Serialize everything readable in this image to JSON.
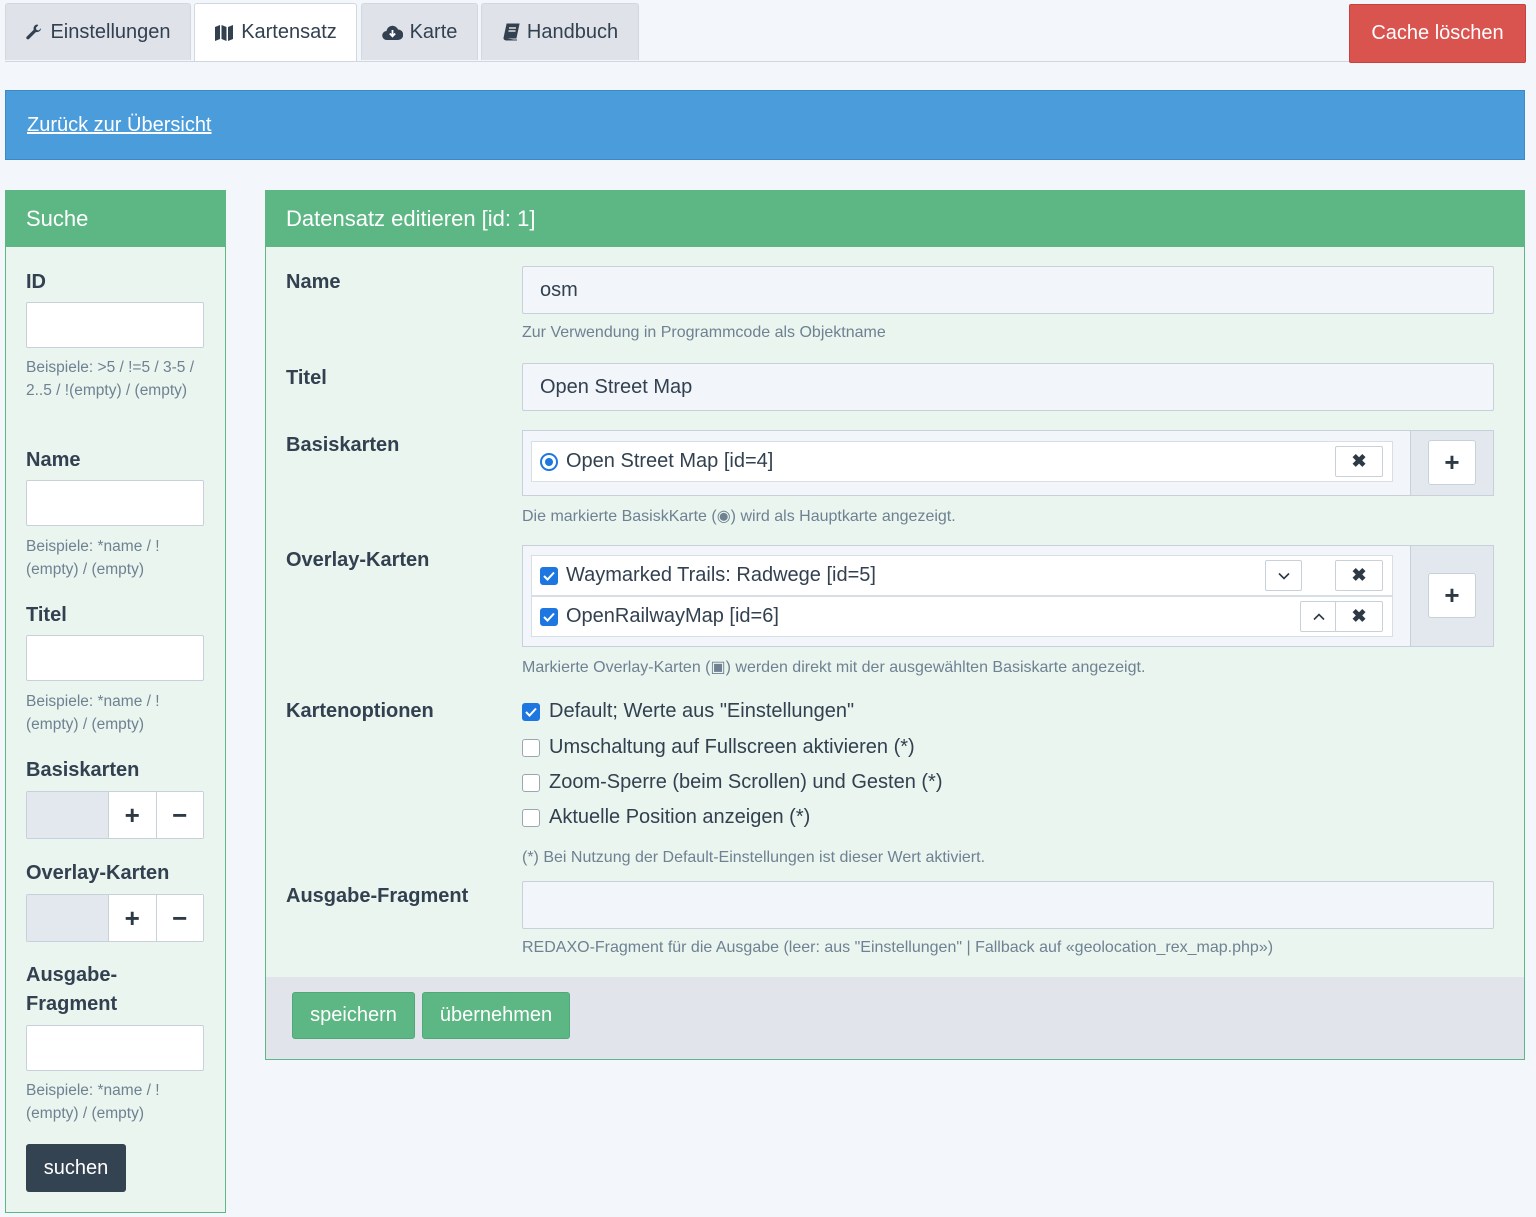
{
  "tabs": [
    {
      "label": "Einstellungen",
      "icon": "wrench-icon"
    },
    {
      "label": "Kartensatz",
      "icon": "map-icon"
    },
    {
      "label": "Karte",
      "icon": "cloud-download-icon"
    },
    {
      "label": "Handbuch",
      "icon": "book-icon"
    }
  ],
  "active_tab": "Kartensatz",
  "cache_button": "Cache löschen",
  "back_link": "Zurück zur Übersicht",
  "search": {
    "title": "Suche",
    "id_label": "ID",
    "id_help": "Beispiele: >5 / !=5 / 3-5 / 2..5 / !(empty) / (empty)",
    "name_label": "Name",
    "name_help": "Beispiele: *name / !(empty) / (empty)",
    "titel_label": "Titel",
    "titel_help": "Beispiele: *name / !(empty) / (empty)",
    "basiskarten_label": "Basiskarten",
    "overlay_label": "Overlay-Karten",
    "fragment_label": "Ausgabe-Fragment",
    "fragment_help": "Beispiele: *name / !(empty) / (empty)",
    "plus": "+",
    "minus": "−",
    "submit": "suchen"
  },
  "edit": {
    "title": "Datensatz editieren [id: 1]",
    "name_label": "Name",
    "name_value": "osm",
    "name_help": "Zur Verwendung in Programmcode als Objektname",
    "titel_label": "Titel",
    "titel_value": "Open Street Map",
    "basiskarten_label": "Basiskarten",
    "basiskarten_items": [
      "Open Street Map [id=4]"
    ],
    "basiskarten_help": "Die markierte BasiskKarte (◉) wird als Hauptkarte angezeigt.",
    "overlay_label": "Overlay-Karten",
    "overlay_items": [
      "Waymarked Trails: Radwege [id=5]",
      "OpenRailwayMap [id=6]"
    ],
    "overlay_help": "Markierte Overlay-Karten (▣) werden direkt mit der ausgewählten Basiskarte angezeigt.",
    "options_label": "Kartenoptionen",
    "options": [
      {
        "label": "Default; Werte aus \"Einstellungen\"",
        "checked": true
      },
      {
        "label": "Umschaltung auf Fullscreen aktivieren (*)",
        "checked": false
      },
      {
        "label": "Zoom-Sperre (beim Scrollen) und Gesten (*)",
        "checked": false
      },
      {
        "label": "Aktuelle Position anzeigen (*)",
        "checked": false
      }
    ],
    "options_help": "(*) Bei Nutzung der Default-Einstellungen ist dieser Wert aktiviert.",
    "fragment_label": "Ausgabe-Fragment",
    "fragment_value": "",
    "fragment_help": "REDAXO-Fragment für die Ausgabe (leer: aus \"Einstellungen\" | Fallback auf «geolocation_rex_map.php»)",
    "save_button": "speichern",
    "apply_button": "übernehmen"
  },
  "colors": {
    "danger": "#d9534f",
    "info": "#4b9cdb",
    "success": "#5cb784",
    "dark_button": "#344352",
    "checkbox": "#1e77e0"
  }
}
